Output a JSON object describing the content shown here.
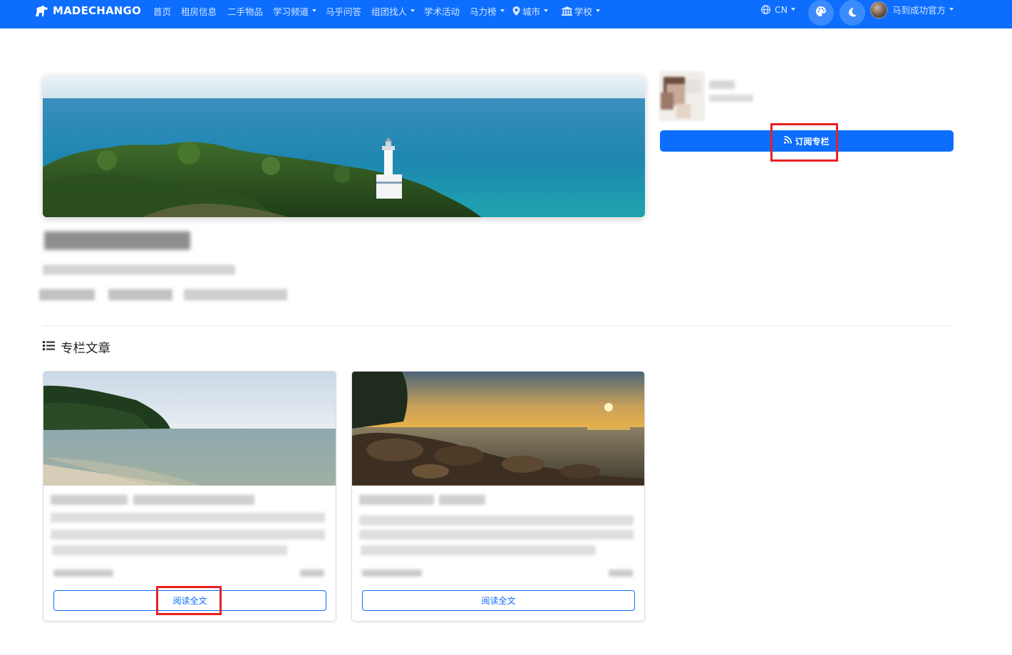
{
  "navbar": {
    "brand": "MADECHANGO",
    "items": [
      {
        "label": "首页",
        "dropdown": false
      },
      {
        "label": "租房信息",
        "dropdown": false
      },
      {
        "label": "二手物品",
        "dropdown": false
      },
      {
        "label": "学习频道",
        "dropdown": true
      },
      {
        "label": "马乎问答",
        "dropdown": false
      },
      {
        "label": "组团找人",
        "dropdown": true
      },
      {
        "label": "学术活动",
        "dropdown": false
      },
      {
        "label": "马力榜",
        "dropdown": true
      },
      {
        "label": "城市",
        "dropdown": true
      },
      {
        "label": "学校",
        "dropdown": true
      }
    ],
    "language": "CN",
    "user_name": "马到成功官方"
  },
  "sidebar": {
    "subscribe_label": "订阅专栏"
  },
  "section": {
    "title": "专栏文章"
  },
  "cards": [
    {
      "read_label": "阅读全文"
    },
    {
      "read_label": "阅读全文"
    }
  ],
  "colors": {
    "primary": "#0d6efd",
    "highlight": "#e8201f"
  },
  "icons": {
    "brand": "horse-icon",
    "map": "map-marker-icon",
    "school": "university-icon",
    "globe": "globe-icon",
    "theme": "palette-icon",
    "dark_mode": "moon-icon",
    "subscribe": "rss-icon",
    "section": "list-icon"
  }
}
